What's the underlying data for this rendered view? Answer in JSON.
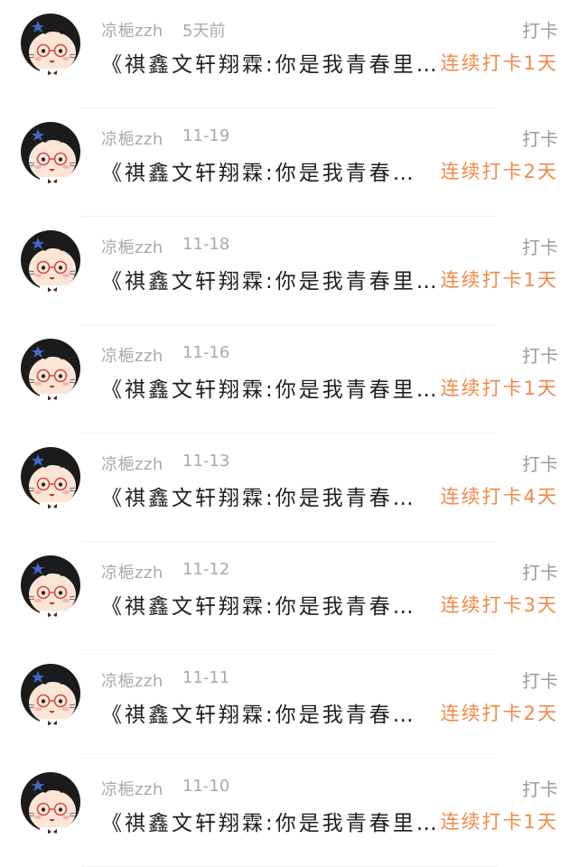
{
  "feed": {
    "items": [
      {
        "username": "凉梔zzh",
        "date": "5天前",
        "type": "打卡",
        "content": "《祺鑫文轩翔霖:你是我青春里…",
        "streak": "连续打卡1天"
      },
      {
        "username": "凉梔zzh",
        "date": "11-19",
        "type": "打卡",
        "content": "《祺鑫文轩翔霖:你是我青春…",
        "streak": "连续打卡2天"
      },
      {
        "username": "凉梔zzh",
        "date": "11-18",
        "type": "打卡",
        "content": "《祺鑫文轩翔霖:你是我青春里…",
        "streak": "连续打卡1天"
      },
      {
        "username": "凉梔zzh",
        "date": "11-16",
        "type": "打卡",
        "content": "《祺鑫文轩翔霖:你是我青春里…",
        "streak": "连续打卡1天"
      },
      {
        "username": "凉梔zzh",
        "date": "11-13",
        "type": "打卡",
        "content": "《祺鑫文轩翔霖:你是我青春…",
        "streak": "连续打卡4天"
      },
      {
        "username": "凉梔zzh",
        "date": "11-12",
        "type": "打卡",
        "content": "《祺鑫文轩翔霖:你是我青春…",
        "streak": "连续打卡3天"
      },
      {
        "username": "凉梔zzh",
        "date": "11-11",
        "type": "打卡",
        "content": "《祺鑫文轩翔霖:你是我青春…",
        "streak": "连续打卡2天"
      },
      {
        "username": "凉梔zzh",
        "date": "11-10",
        "type": "打卡",
        "content": "《祺鑫文轩翔霖:你是我青春里…",
        "streak": "连续打卡1天"
      }
    ]
  },
  "icons": {
    "avatar": "cartoon-girl-avatar-icon"
  },
  "colors": {
    "accent": "#ef8a47",
    "meta_text": "#a9a9a9",
    "body_text": "#1f1f1f"
  }
}
